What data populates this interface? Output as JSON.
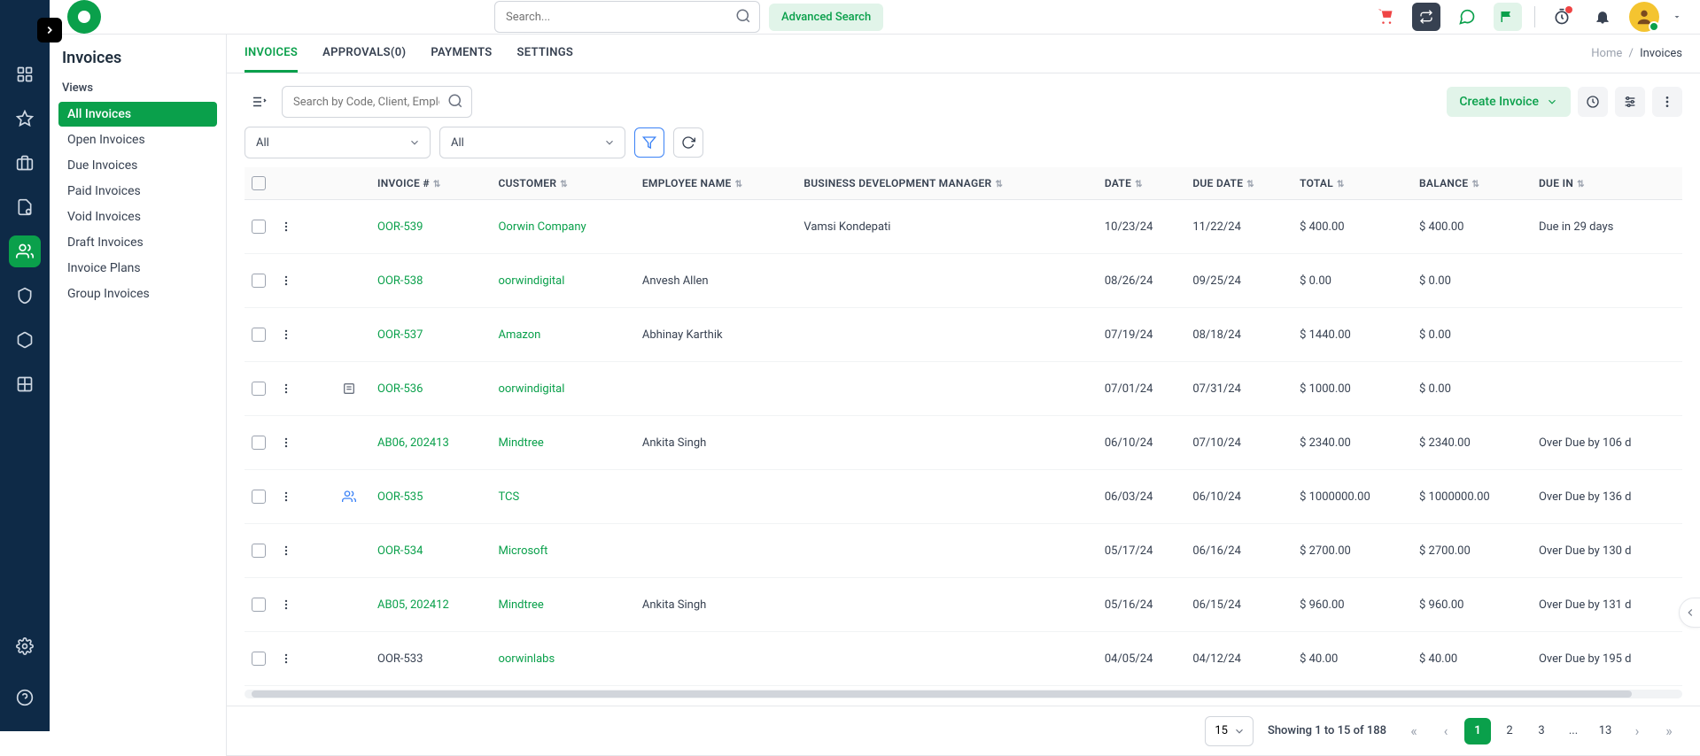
{
  "top": {
    "search_placeholder": "Search...",
    "advanced_search": "Advanced Search"
  },
  "sidebar": {
    "title": "Invoices",
    "views_label": "Views",
    "items": [
      {
        "label": "All Invoices",
        "active": true
      },
      {
        "label": "Open Invoices"
      },
      {
        "label": "Due Invoices"
      },
      {
        "label": "Paid Invoices"
      },
      {
        "label": "Void Invoices"
      },
      {
        "label": "Draft Invoices"
      },
      {
        "label": "Invoice Plans"
      },
      {
        "label": "Group Invoices"
      }
    ]
  },
  "tabs": [
    {
      "label": "INVOICES",
      "active": true
    },
    {
      "label": "APPROVALS(0)"
    },
    {
      "label": "PAYMENTS"
    },
    {
      "label": "SETTINGS"
    }
  ],
  "breadcrumb": {
    "home": "Home",
    "sep": "/",
    "current": "Invoices"
  },
  "toolbar": {
    "search_placeholder": "Search by Code, Client, Employee",
    "create_label": "Create Invoice",
    "filter1": "All",
    "filter2": "All"
  },
  "columns": [
    "",
    "",
    "",
    "",
    "INVOICE #",
    "CUSTOMER",
    "EMPLOYEE NAME",
    "BUSINESS DEVELOPMENT MANAGER",
    "DATE",
    "DUE DATE",
    "TOTAL",
    "BALANCE",
    "DUE IN"
  ],
  "rows": [
    {
      "invoice": "OOR-539",
      "invoice_link": true,
      "customer": "Oorwin Company",
      "employee": "",
      "bdm": "Vamsi Kondepati",
      "date": "10/23/24",
      "due_date": "11/22/24",
      "total": "$ 400.00",
      "balance": "$ 400.00",
      "due_in": "Due in 29 days"
    },
    {
      "invoice": "OOR-538",
      "invoice_link": true,
      "customer": "oorwindigital",
      "employee": "Anvesh Allen",
      "bdm": "",
      "date": "08/26/24",
      "due_date": "09/25/24",
      "total": "$ 0.00",
      "balance": "$ 0.00",
      "due_in": ""
    },
    {
      "invoice": "OOR-537",
      "invoice_link": true,
      "customer": "Amazon",
      "employee": "Abhinay Karthik",
      "bdm": "",
      "date": "07/19/24",
      "due_date": "08/18/24",
      "total": "$ 1440.00",
      "balance": "$ 0.00",
      "due_in": ""
    },
    {
      "invoice": "OOR-536",
      "invoice_link": true,
      "customer": "oorwindigital",
      "employee": "",
      "bdm": "",
      "date": "07/01/24",
      "due_date": "07/31/24",
      "total": "$ 1000.00",
      "balance": "$ 0.00",
      "due_in": "",
      "row_icon": "gray"
    },
    {
      "invoice": "AB06, 202413",
      "invoice_link": true,
      "customer": "Mindtree",
      "employee": "Ankita Singh",
      "bdm": "",
      "date": "06/10/24",
      "due_date": "07/10/24",
      "total": "$ 2340.00",
      "balance": "$ 2340.00",
      "due_in": "Over Due by 106 d"
    },
    {
      "invoice": "OOR-535",
      "invoice_link": true,
      "customer": "TCS",
      "employee": "",
      "bdm": "",
      "date": "06/03/24",
      "due_date": "06/10/24",
      "total": "$ 1000000.00",
      "balance": "$ 1000000.00",
      "due_in": "Over Due by 136 d",
      "row_icon": "blue"
    },
    {
      "invoice": "OOR-534",
      "invoice_link": true,
      "customer": "Microsoft",
      "employee": "",
      "bdm": "",
      "date": "05/17/24",
      "due_date": "06/16/24",
      "total": "$ 2700.00",
      "balance": "$ 2700.00",
      "due_in": "Over Due by 130 d"
    },
    {
      "invoice": "AB05, 202412",
      "invoice_link": true,
      "customer": "Mindtree",
      "employee": "Ankita Singh",
      "bdm": "",
      "date": "05/16/24",
      "due_date": "06/15/24",
      "total": "$ 960.00",
      "balance": "$ 960.00",
      "due_in": "Over Due by 131 d"
    },
    {
      "invoice": "OOR-533",
      "invoice_link": false,
      "customer": "oorwinlabs",
      "employee": "",
      "bdm": "",
      "date": "04/05/24",
      "due_date": "04/12/24",
      "total": "$ 40.00",
      "balance": "$ 40.00",
      "due_in": "Over Due by 195 d"
    }
  ],
  "pagination": {
    "page_size": "15",
    "showing": "Showing 1 to 15 of 188",
    "pages": [
      "1",
      "2",
      "3",
      "...",
      "13"
    ],
    "active_page": "1"
  }
}
